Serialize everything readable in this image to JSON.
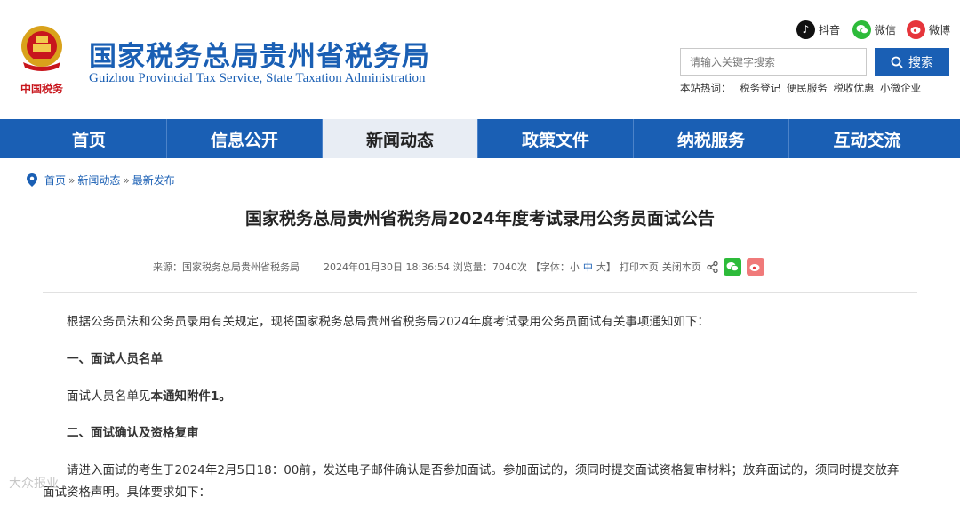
{
  "header": {
    "title": "国家税务总局贵州省税务局",
    "subtitle": "Guizhou Provincial Tax Service, State Taxation Administration",
    "logo_text": "中国税务",
    "social": [
      {
        "label": "抖音",
        "icon": "douyin-icon"
      },
      {
        "label": "微信",
        "icon": "wechat-icon"
      },
      {
        "label": "微博",
        "icon": "weibo-icon"
      }
    ],
    "search_placeholder": "请输入关键字搜索",
    "search_button": "搜索",
    "hot_label": "本站热词：",
    "hot_words": [
      "税务登记",
      "便民服务",
      "税收优惠",
      "小微企业"
    ]
  },
  "nav": {
    "items": [
      "首页",
      "信息公开",
      "新闻动态",
      "政策文件",
      "纳税服务",
      "互动交流"
    ],
    "active": "新闻动态"
  },
  "breadcrumb": {
    "home": "首页",
    "sep": "»",
    "level1": "新闻动态",
    "level2": "最新发布"
  },
  "article": {
    "title": "国家税务总局贵州省税务局2024年度考试录用公务员面试公告",
    "source": "来源：国家税务总局贵州省税务局",
    "datetime": "2024年01月30日 18:36:54",
    "views": "浏览量：7040次",
    "font_label_open": "【字体：",
    "font_small": "小",
    "font_medium": "中",
    "font_large": "大",
    "font_label_close": "】",
    "print": "打印本页",
    "close": "关闭本页",
    "paragraphs": {
      "intro": "根据公务员法和公务员录用有关规定，现将国家税务总局贵州省税务局2024年度考试录用公务员面试有关事项通知如下：",
      "h1": "一、面试人员名单",
      "p1_a": "面试人员名单见",
      "p1_b": "本通知附件1",
      "p1_c": "。",
      "h2": "二、面试确认及资格复审",
      "p2_line1": "请进入面试的考生于2024年2月5日18：00前，发送电子邮件确认是否参加面试。参加面试的，须同时提交面试资格复审材料；放弃面试的，须同时提交放弃",
      "p2_line2": "面试资格声明。具体要求如下："
    }
  },
  "watermark": "大众报业"
}
